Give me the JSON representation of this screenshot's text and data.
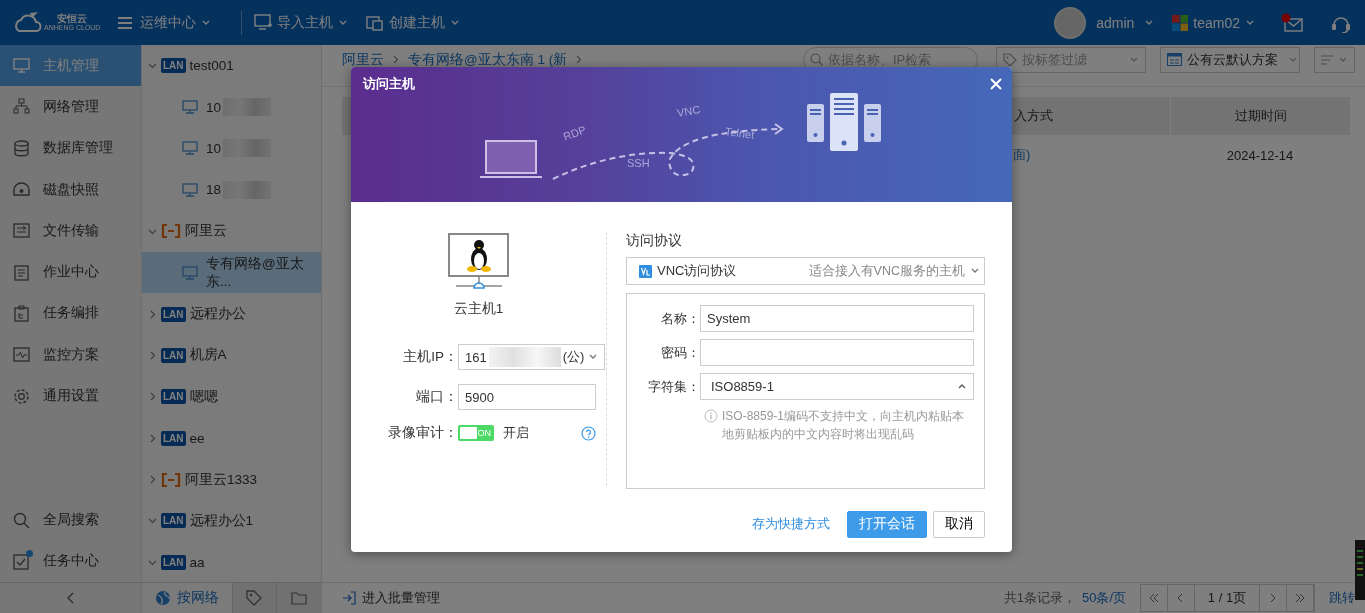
{
  "header": {
    "logo_text": "安恒云",
    "logo_subtext": "ANHENG CLOUD",
    "module": "运维中心",
    "actions": [
      "导入主机",
      "创建主机"
    ],
    "user": "admin",
    "team": "team02",
    "mail_unread": true
  },
  "sidebar": {
    "items": [
      {
        "label": "主机管理",
        "selected": true
      },
      {
        "label": "网络管理",
        "selected": false
      },
      {
        "label": "数据库管理",
        "selected": false
      },
      {
        "label": "磁盘快照",
        "selected": false
      },
      {
        "label": "文件传输",
        "selected": false
      },
      {
        "label": "作业中心",
        "selected": false
      },
      {
        "label": "任务编排",
        "selected": false
      },
      {
        "label": "监控方案",
        "selected": false
      },
      {
        "label": "通用设置",
        "selected": false
      }
    ],
    "bottom_items": [
      {
        "label": "全局搜索",
        "notification": false
      },
      {
        "label": "任务中心",
        "notification": true
      }
    ]
  },
  "tree": {
    "nodes": [
      {
        "kind": "lan",
        "badge": "LAN",
        "label": "test001",
        "expanded": true,
        "selected": false,
        "children": [
          {
            "kind": "host",
            "label": "10",
            "redacted": true,
            "selected": false
          },
          {
            "kind": "host",
            "label": "10",
            "redacted": true,
            "selected": false
          },
          {
            "kind": "host",
            "label": "18",
            "redacted": true,
            "selected": false
          }
        ]
      },
      {
        "kind": "cloud",
        "label": "阿里云",
        "expanded": true,
        "selected": false,
        "children": [
          {
            "kind": "host",
            "label": "专有网络@亚太东...",
            "redacted": false,
            "selected": true
          }
        ]
      },
      {
        "kind": "lan",
        "badge": "LAN",
        "label": "远程办公",
        "expanded": false,
        "selected": false
      },
      {
        "kind": "lan",
        "badge": "LAN",
        "label": "机房A",
        "expanded": false,
        "selected": false
      },
      {
        "kind": "lan",
        "badge": "LAN",
        "label": "嗯嗯",
        "expanded": false,
        "selected": false
      },
      {
        "kind": "lan",
        "badge": "LAN",
        "label": "ee",
        "expanded": false,
        "selected": false
      },
      {
        "kind": "cloud",
        "label": "阿里云1333",
        "expanded": false,
        "selected": false
      },
      {
        "kind": "lan",
        "badge": "LAN",
        "label": "远程办公1",
        "expanded": true,
        "selected": false
      },
      {
        "kind": "lan",
        "badge": "LAN",
        "label": "aa",
        "expanded": true,
        "selected": false
      }
    ],
    "tabs": [
      {
        "label": "按网络",
        "selected": true
      },
      {
        "selected": false
      },
      {
        "selected": false
      }
    ]
  },
  "main": {
    "breadcrumb": [
      "阿里云",
      "专有网络@亚太东南 1 (新"
    ],
    "search_placeholder": "依据名称、IP检索",
    "tag_filter_placeholder": "按标签过滤",
    "scheme": "公有云默认方案",
    "table": {
      "columns": [
        "入方式",
        "过期时间"
      ],
      "rows": [
        [
          "面)",
          "2024-12-14"
        ]
      ]
    },
    "footer": {
      "batch": "进入批量管理",
      "record_count": "共1条记录，",
      "page_size": "50条/页",
      "page": "1 / 1页",
      "jump": "跳转"
    }
  },
  "dialog": {
    "title": "访问主机",
    "illustration_labels": [
      "RDP",
      "SSH",
      "VNC",
      "Telnet"
    ],
    "host_name": "云主机1",
    "host_ip": {
      "label": "主机IP：",
      "value": "161",
      "redacted": true,
      "suffix": "(公)"
    },
    "port": {
      "label": "端口：",
      "value": "5900"
    },
    "recording": {
      "label": "录像审计：",
      "on": true,
      "switch_text": "ON",
      "status": "开启"
    },
    "protocol": {
      "label": "访问协议",
      "name": "VNC访问协议",
      "description": "适合接入有VNC服务的主机"
    },
    "fields": [
      {
        "kind": "text",
        "label": "名称：",
        "value": "System"
      },
      {
        "kind": "password",
        "label": "密码："
      },
      {
        "kind": "select",
        "label": "字符集：",
        "value": "ISO8859-1",
        "expanded": true
      }
    ],
    "hint": "ISO-8859-1编码不支持中文，向主机内粘贴本地剪贴板内的中文内容时将出现乱码",
    "buttons": {
      "shortcut": "存为快捷方式",
      "open": "打开会话",
      "cancel": "取消"
    }
  }
}
